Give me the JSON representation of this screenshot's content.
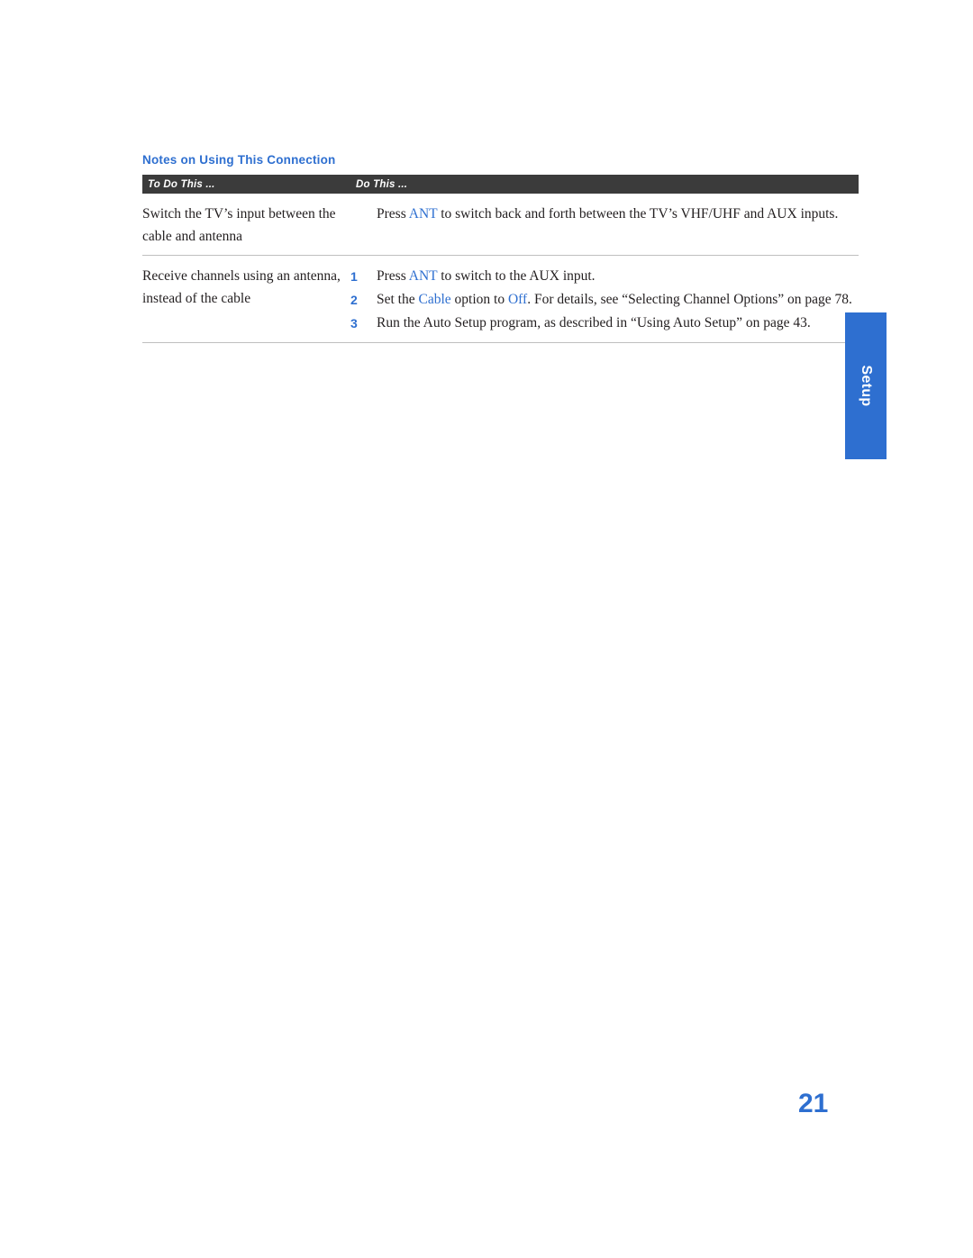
{
  "section": {
    "heading": "Notes on Using This Connection"
  },
  "table": {
    "columns": [
      "To Do This ...",
      "Do This ..."
    ],
    "rows": [
      {
        "left": "Switch the TV’s input between the cable and antenna",
        "right_type": "text",
        "right_parts": [
          {
            "t": "Press ",
            "kw": false
          },
          {
            "t": "ANT",
            "kw": true
          },
          {
            "t": " to switch back and forth between the TV’s VHF/UHF and AUX inputs.",
            "kw": false
          }
        ]
      },
      {
        "left": "Receive channels using an antenna, instead of the cable",
        "right_type": "steps",
        "steps": [
          {
            "num": "1",
            "parts": [
              {
                "t": "Press ",
                "kw": false
              },
              {
                "t": "ANT",
                "kw": true
              },
              {
                "t": " to switch to the AUX input.",
                "kw": false
              }
            ]
          },
          {
            "num": "2",
            "parts": [
              {
                "t": "Set the ",
                "kw": false
              },
              {
                "t": "Cable",
                "kw": true
              },
              {
                "t": " option to ",
                "kw": false
              },
              {
                "t": "Off",
                "kw": true
              },
              {
                "t": ". For details, see “Selecting Channel Options” on page 78.",
                "kw": false
              }
            ]
          },
          {
            "num": "3",
            "parts": [
              {
                "t": "Run the Auto Setup program, as described in “Using Auto Setup” on page 43.",
                "kw": false
              }
            ]
          }
        ]
      }
    ]
  },
  "side_tab": {
    "label": "Setup",
    "color": "#2e6fd0"
  },
  "page_number": "21"
}
